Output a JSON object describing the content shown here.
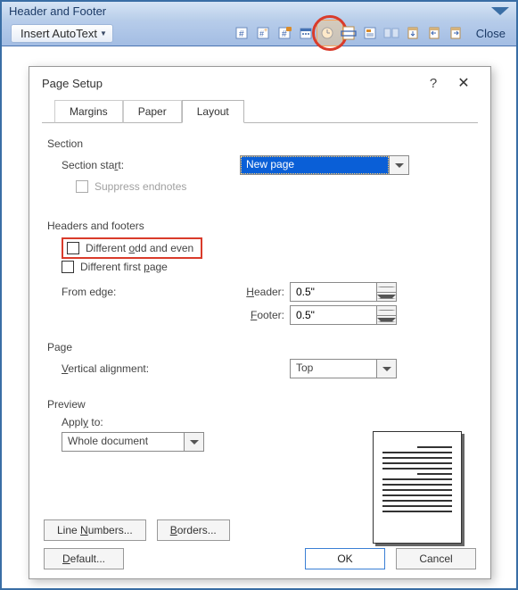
{
  "toolbar": {
    "title": "Header and Footer",
    "autotext_label": "Insert AutoText",
    "close_label": "Close"
  },
  "dialog": {
    "title": "Page Setup",
    "tabs": {
      "margins": "Margins",
      "paper": "Paper",
      "layout": "Layout"
    }
  },
  "section": {
    "label": "Section",
    "start_label": "Section start:",
    "start_value": "New page",
    "suppress_label": "Suppress endnotes"
  },
  "headers": {
    "label": "Headers and footers",
    "odd_even": "Different odd and even",
    "first_page": "Different first page",
    "from_edge": "From edge:",
    "header_label": "Header:",
    "footer_label": "Footer:",
    "header_value": "0.5\"",
    "footer_value": "0.5\""
  },
  "page": {
    "label": "Page",
    "valign_label": "Vertical alignment:",
    "valign_value": "Top"
  },
  "preview": {
    "label": "Preview",
    "apply_label": "Apply to:",
    "apply_value": "Whole document"
  },
  "buttons": {
    "line_numbers": "Line Numbers...",
    "borders": "Borders...",
    "default": "Default...",
    "ok": "OK",
    "cancel": "Cancel"
  }
}
